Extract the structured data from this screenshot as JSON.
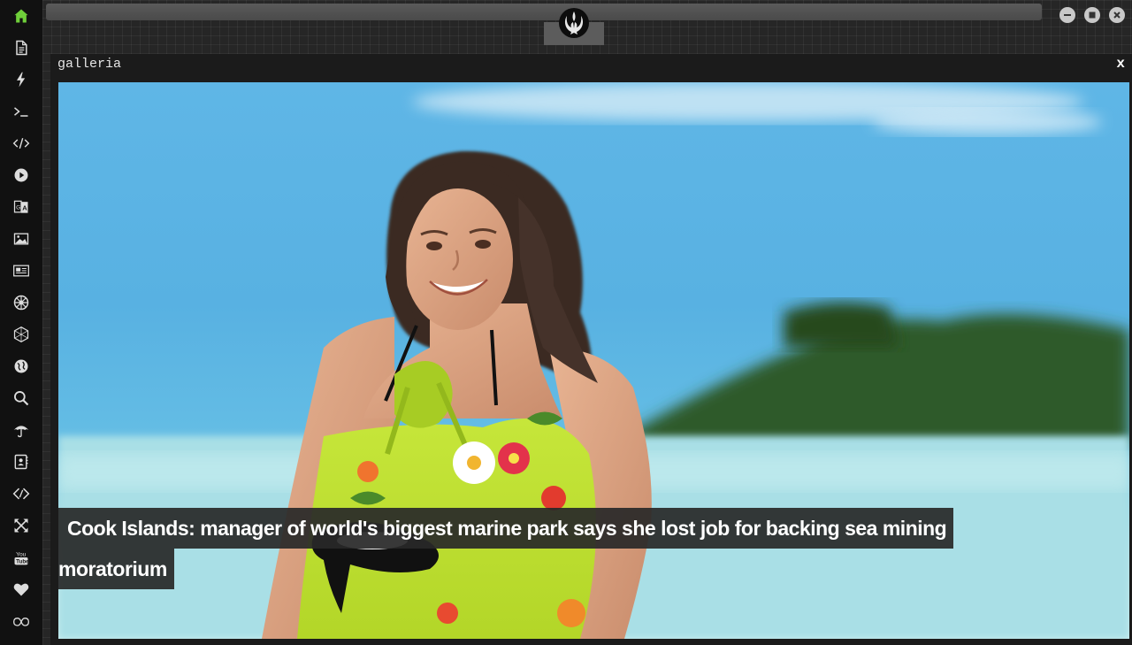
{
  "sidebar": {
    "items": [
      {
        "icon": "home-icon"
      },
      {
        "icon": "document-icon"
      },
      {
        "icon": "lightning-icon"
      },
      {
        "icon": "terminal-icon"
      },
      {
        "icon": "code-icon"
      },
      {
        "icon": "play-icon"
      },
      {
        "icon": "translate-icon"
      },
      {
        "icon": "image-icon"
      },
      {
        "icon": "newspaper-icon"
      },
      {
        "icon": "empire-icon"
      },
      {
        "icon": "hexagon-network-icon"
      },
      {
        "icon": "globe-icon"
      },
      {
        "icon": "search-icon"
      },
      {
        "icon": "umbrella-icon"
      },
      {
        "icon": "contacts-icon"
      },
      {
        "icon": "code-diamond-icon"
      },
      {
        "icon": "expand-icon"
      },
      {
        "icon": "youtube-icon"
      },
      {
        "icon": "heart-icon"
      },
      {
        "icon": "infinity-cloud-icon"
      }
    ],
    "active_color": "#6fcf3a"
  },
  "titlebar": {
    "logo": "rebel-alliance-icon"
  },
  "window": {
    "title": "galleria",
    "close_label": "x"
  },
  "gallery": {
    "caption_line1": "Cook Islands: manager of world's biggest marine park says she lost job for backing sea mining",
    "caption_line2": "moratorium"
  }
}
